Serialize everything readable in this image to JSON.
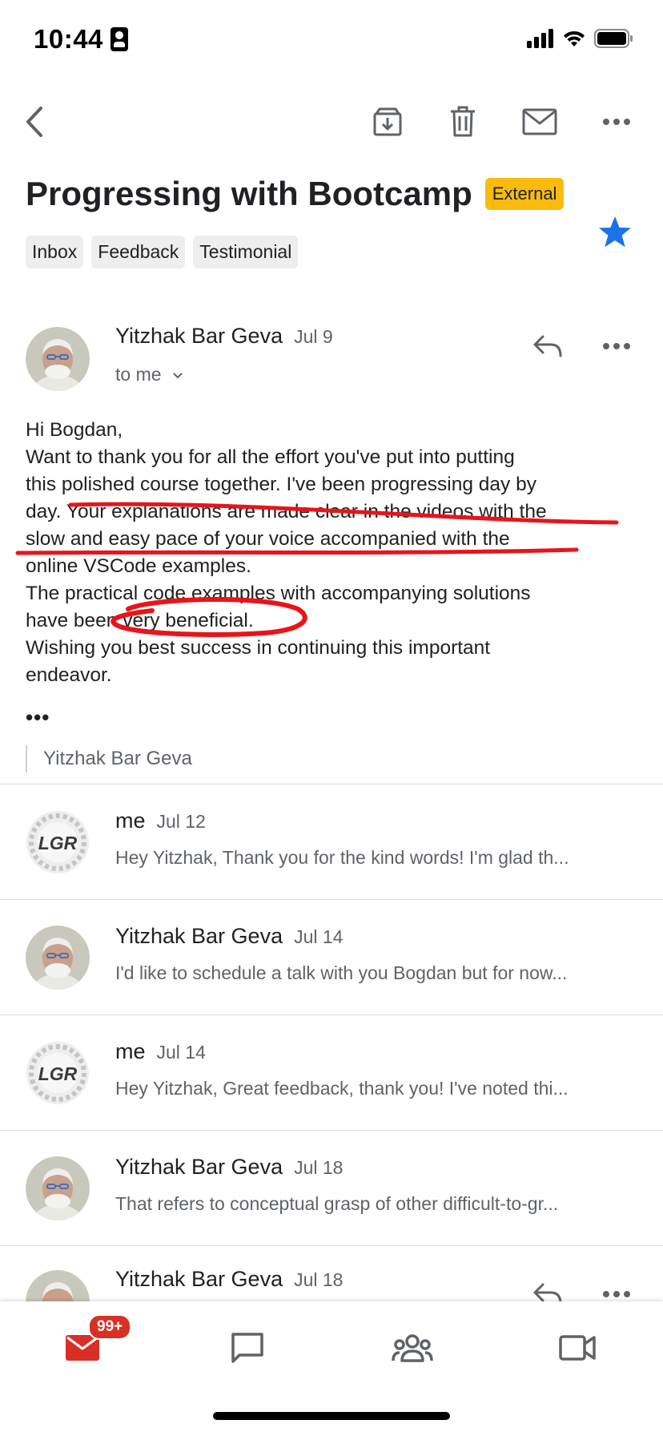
{
  "status_bar": {
    "time": "10:44"
  },
  "toolbar": {
    "icons": [
      "back-arrow-icon",
      "archive-icon",
      "trash-icon",
      "mark-unread-icon",
      "more-icon"
    ]
  },
  "email": {
    "subject": "Progressing with Bootcamp",
    "external_badge": "External",
    "labels": [
      "Inbox",
      "Feedback",
      "Testimonial"
    ],
    "starred": true,
    "star_color": "#1a73e8"
  },
  "expanded_message": {
    "sender": "Yitzhak Bar Geva",
    "date": "Jul 9",
    "recipient": "to me",
    "body_lines": [
      "Hi Bogdan,",
      "Want to thank you for all the effort you've put into putting",
      "this polished course together. I've been progressing day by",
      "day. Your explanations are made clear in the videos with the",
      "slow and easy pace of your voice accompanied with the",
      "online VSCode examples.",
      "The practical code examples with accompanying solutions",
      "have been very beneficial.",
      "Wishing you best success in continuing this important",
      "endeavor."
    ],
    "expand_dots": "•••",
    "signature": "Yitzhak Bar Geva",
    "annotation_color": "#e8141a"
  },
  "thread": [
    {
      "sender": "me",
      "date": "Jul 12",
      "snippet": "Hey Yitzhak, Thank you for the kind words! I'm glad th...",
      "avatar": "lgr-logo"
    },
    {
      "sender": "Yitzhak Bar Geva",
      "date": "Jul 14",
      "snippet": "I'd like to schedule a talk with you Bogdan but for now...",
      "avatar": "photo"
    },
    {
      "sender": "me",
      "date": "Jul 14",
      "snippet": "Hey Yitzhak, Great feedback, thank you! I've noted thi...",
      "avatar": "lgr-logo"
    },
    {
      "sender": "Yitzhak Bar Geva",
      "date": "Jul 18",
      "snippet": "That refers to conceptual grasp of other difficult-to-gr...",
      "avatar": "photo"
    }
  ],
  "last_message": {
    "sender": "Yitzhak Bar Geva",
    "date": "Jul 18"
  },
  "bottom_nav": {
    "mail_badge": "99+",
    "items": [
      "mail-icon",
      "chat-icon",
      "spaces-icon",
      "meet-icon"
    ],
    "accent": "#d93025"
  }
}
